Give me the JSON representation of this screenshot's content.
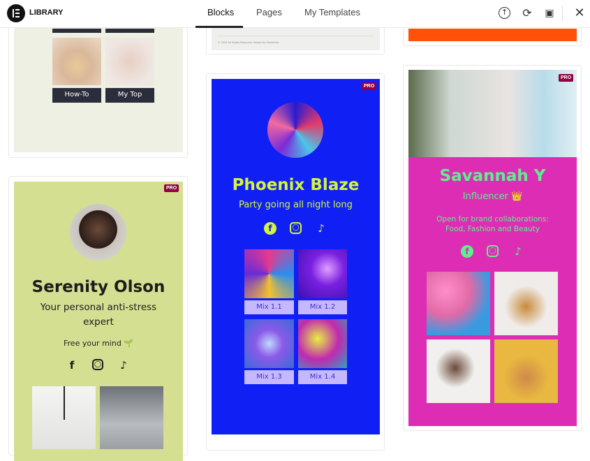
{
  "header": {
    "title": "LIBRARY",
    "tabs": [
      {
        "label": "Blocks",
        "active": true
      },
      {
        "label": "Pages"
      },
      {
        "label": "My Templates"
      }
    ],
    "icons": [
      "upload-icon",
      "sync-icon",
      "save-icon",
      "close-icon"
    ]
  },
  "col1": {
    "top_card": {
      "buttons": [
        "How-To",
        "My Top"
      ]
    },
    "serenity": {
      "badge": "PRO",
      "name": "Serenity Olson",
      "subtitle": "Your personal anti-stress expert",
      "tagline": "Free your mind 🌱",
      "bg": "#d4df92"
    }
  },
  "col2": {
    "top_card": {
      "footer_text": "© 2024 All Rights Reserved. Design by Elementor"
    },
    "phoenix": {
      "badge": "PRO",
      "name": "Phoenix Blaze",
      "subtitle": "Party going all night long",
      "mixes": [
        "Mix 1.1",
        "Mix 1.2",
        "Mix 1.3",
        "Mix 1.4"
      ],
      "bg": "#1020f5",
      "accent": "#d4f53c"
    }
  },
  "col3": {
    "top_card": {
      "bg": "#ff5208"
    },
    "savannah": {
      "badge": "PRO",
      "name": "Savannah Y",
      "role": "Influencer 👑",
      "text": "Open for brand collaborations: Food, Fashion and Beauty",
      "bg": "#dd2db4",
      "accent": "#5ff08e"
    }
  }
}
